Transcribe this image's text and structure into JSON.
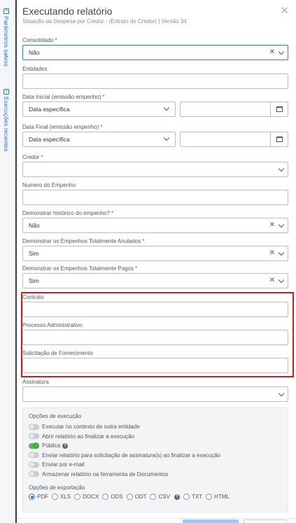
{
  "sidebar": {
    "tab_saved": "Parâmetros salvos",
    "tab_recent": "Execuções recentes"
  },
  "modal": {
    "title": "Executando relatório",
    "subtitle": "Situação da Despesa por Credor - (Extrato do Credor) | Versão 34"
  },
  "fields": {
    "consolidado": {
      "label": "Consolidado",
      "value": "Não"
    },
    "entidades": {
      "label": "Entidades",
      "value": ""
    },
    "data_inicial": {
      "label": "Data Inicial (emissão empenho)",
      "value": "Data específica",
      "date": ""
    },
    "data_final": {
      "label": "Data Final (emissão empenho)",
      "value": "Data específica",
      "date": ""
    },
    "credor": {
      "label": "Credor",
      "value": ""
    },
    "numero_empenho": {
      "label": "Numero do Empenho",
      "value": ""
    },
    "historico": {
      "label": "Demonstrar histórico do empenho?",
      "value": "Não"
    },
    "anulados": {
      "label": "Demonstrar os Empenhos Totalmente Anulados",
      "value": "Sim"
    },
    "pagos": {
      "label": "Demonstrar os Empenhos Totalmente Pagos",
      "value": "Sim"
    },
    "contrato": {
      "label": "Contrato",
      "value": ""
    },
    "processo": {
      "label": "Processo Administrativo",
      "value": ""
    },
    "solicitacao": {
      "label": "Solicitação de Fornecimento",
      "value": ""
    },
    "assinatura": {
      "label": "Assinatura",
      "value": ""
    }
  },
  "execution_options": {
    "heading": "Opções de execução",
    "items": [
      {
        "label": "Executar no contexto de outra entidade",
        "on": false
      },
      {
        "label": "Abrir relatório ao finalizar a execução",
        "on": false
      },
      {
        "label": "Pública",
        "on": true
      },
      {
        "label": "Enviar relatório para solicitação de assinatura(s) ao finalizar a execução",
        "on": false
      },
      {
        "label": "Enviar por e-mail",
        "on": false
      },
      {
        "label": "Armazenar relatório na ferramenta de Documentos",
        "on": false
      }
    ]
  },
  "export_options": {
    "heading": "Opções de exportação",
    "formats": [
      "PDF",
      "XLS",
      "DOCX",
      "ODS",
      "ODT",
      "CSV",
      "TXT",
      "HTML"
    ],
    "selected": "PDF"
  },
  "colors": {
    "required": "#d32f2f",
    "highlight": "#e0161d",
    "accent": "#2a6fc9",
    "toggle_on": "#5cb85c"
  }
}
